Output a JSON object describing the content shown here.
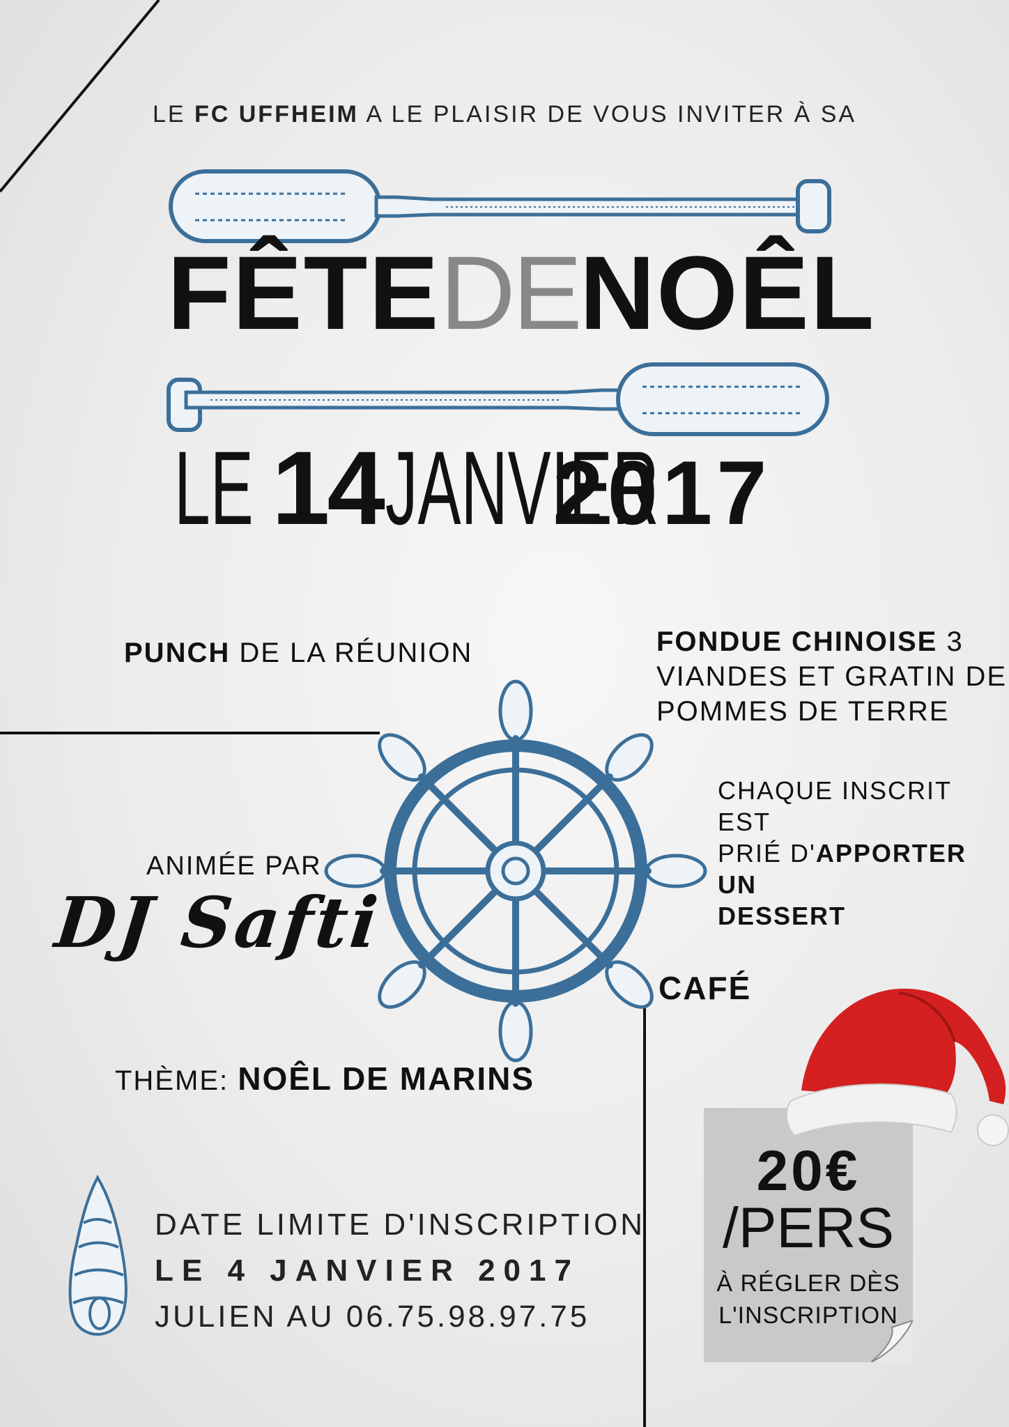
{
  "intro": {
    "prefix": "Le ",
    "club": "FC UFFHEIM",
    "suffix": " a le plaisir de vous inviter à sa"
  },
  "title": {
    "word1": "FÊTE",
    "word2": "DE",
    "word3": "NOÊL"
  },
  "date": {
    "le": "LE",
    "day": "14",
    "month": "JANVIER",
    "year": "2017"
  },
  "punch": {
    "bold": "PUNCH",
    "rest": " DE LA RÉUNION"
  },
  "fondue": {
    "bold": "FONDUE CHINOISE",
    "rest1": " 3",
    "line2": "VIANDES ET GRATIN DE",
    "line3": "POMMES DE TERRE"
  },
  "dessert": {
    "line1": "CHAQUE INSCRIT EST",
    "line2_a": "PRIÉ D'",
    "line2_b": "APPORTER UN",
    "line3": "DESSERT"
  },
  "animee": {
    "label": "ANIMÉE PAR",
    "dj": "DJ Safti"
  },
  "cafe": "CAFÉ",
  "theme": {
    "label": "THÈME: ",
    "value": "NOÊL DE MARINS"
  },
  "price": {
    "amount": "20€",
    "unit": "/PERS",
    "note1": "À RÉGLER DÈS",
    "note2": "L'INSCRIPTION"
  },
  "deadline": {
    "line1": "Date limite d'inscription",
    "line2": "le 4 Janvier 2017",
    "line3": "Julien au 06.75.98.97.75"
  },
  "colors": {
    "accent_blue": "#3b6f99",
    "hat_red": "#d42020",
    "grey_box": "#c9c9c9"
  }
}
